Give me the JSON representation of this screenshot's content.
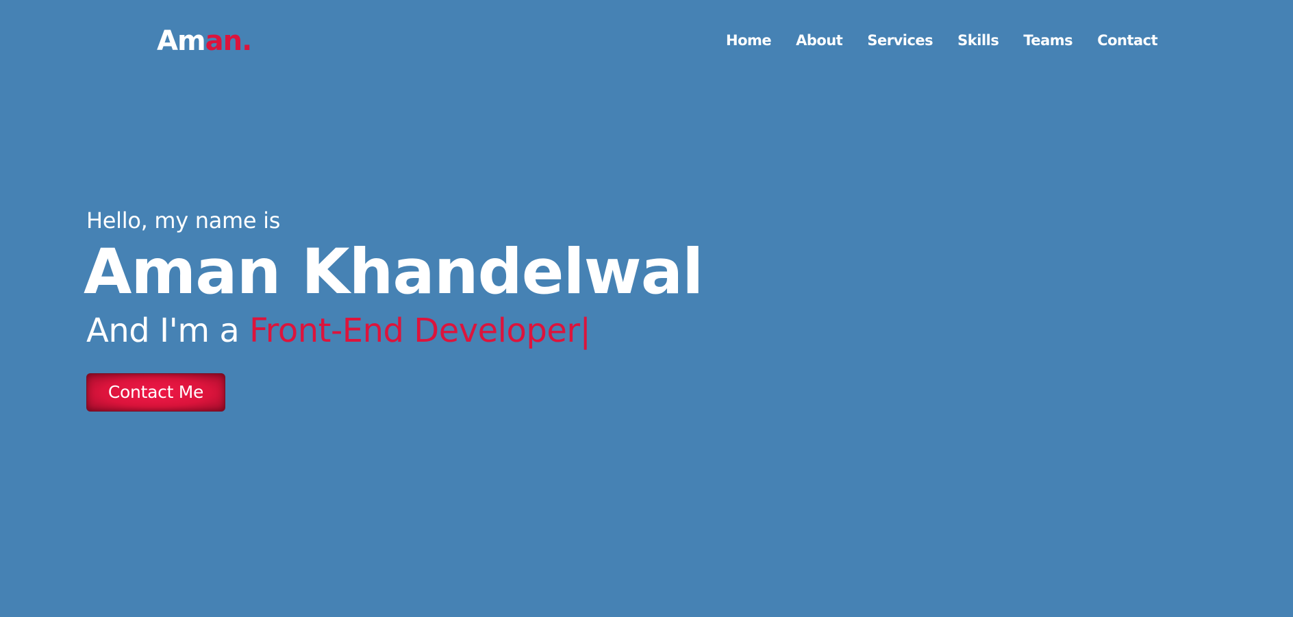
{
  "navbar": {
    "logo": {
      "main": "Am",
      "accent": "an."
    },
    "menu": [
      {
        "label": "Home"
      },
      {
        "label": "About"
      },
      {
        "label": "Services"
      },
      {
        "label": "Skills"
      },
      {
        "label": "Teams"
      },
      {
        "label": "Contact"
      }
    ]
  },
  "hero": {
    "intro": "Hello, my name is",
    "name": "Aman Khandelwal",
    "role_prefix": "And I'm a ",
    "role_typed": "Front-End Developer",
    "cursor": "|",
    "cta_label": "Contact Me"
  },
  "colors": {
    "background": "#4682b4",
    "accent": "#dc143c",
    "text": "#ffffff"
  }
}
